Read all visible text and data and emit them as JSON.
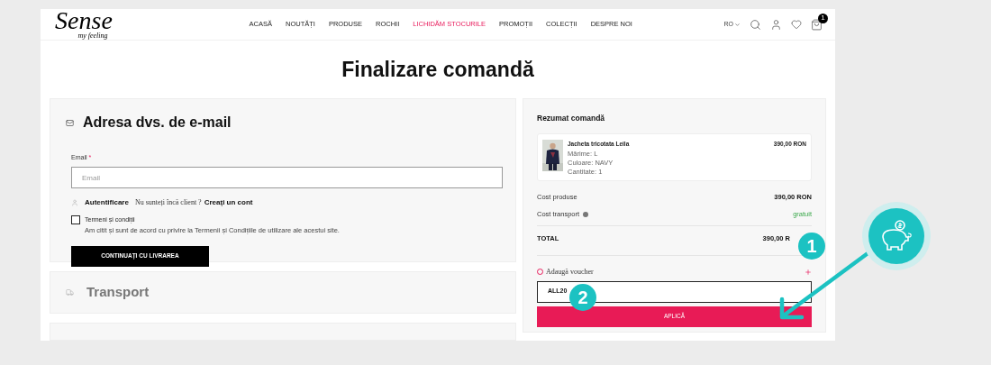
{
  "header": {
    "logo": {
      "name": "Sense",
      "tagline": "my feeling"
    },
    "nav": [
      {
        "label": "ACASĂ",
        "highlighted": false
      },
      {
        "label": "NOUTĂȚI",
        "highlighted": false
      },
      {
        "label": "PRODUSE",
        "highlighted": false
      },
      {
        "label": "ROCHII",
        "highlighted": false
      },
      {
        "label": "LICHIDĂM STOCURILE",
        "highlighted": true
      },
      {
        "label": "PROMOȚII",
        "highlighted": false
      },
      {
        "label": "COLECȚII",
        "highlighted": false
      },
      {
        "label": "DESPRE NOI",
        "highlighted": false
      }
    ],
    "language": "RO",
    "cart_count": "1"
  },
  "title": "Finalizare comandă",
  "email_section": {
    "title": "Adresa dvs. de e-mail",
    "field_label": "Email",
    "required_mark": "*",
    "placeholder": "Email",
    "login_link": "Autentificare",
    "prompt": "Nu sunteți încă client ?",
    "create_link": "Creați un cont",
    "terms": {
      "title": "Termeni și condiții",
      "text": "Am citit și sunt de acord cu privire la Termenii și Condițiile de utilizare ale acestui site.",
      "checked": false
    },
    "continue_button": "CONTINUAȚI CU LIVRAREA"
  },
  "transport_section": {
    "title": "Transport"
  },
  "summary": {
    "title": "Rezumat comandă",
    "items": [
      {
        "name": "Jacheta tricotata Leila",
        "details": [
          "Mărime: L",
          "Culoare: NAVY",
          "Cantitate: 1"
        ],
        "price": "390,00 RON"
      }
    ],
    "rows": [
      {
        "label": "Cost produse",
        "value": "390,00 RON",
        "kind": "normal",
        "help": false
      },
      {
        "label": "Cost transport",
        "value": "gratuit",
        "kind": "free",
        "help": true
      }
    ],
    "total": {
      "label": "TOTAL",
      "value": "390,00 R"
    },
    "voucher": {
      "label": "Adaugă voucher",
      "code": "ALL20",
      "button": "APLICĂ"
    }
  },
  "annotations": [
    {
      "number": "1"
    },
    {
      "number": "2"
    }
  ]
}
